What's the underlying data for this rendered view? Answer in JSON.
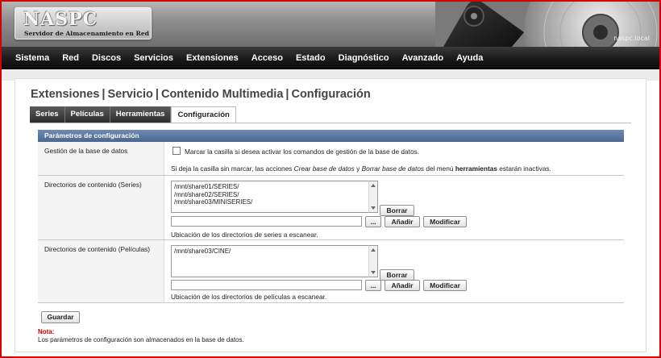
{
  "header": {
    "logo_title": "NASPC",
    "logo_subtitle": "Servidor de Almacenamiento en Red",
    "hostname": "naspc.local"
  },
  "nav": {
    "items": [
      "Sistema",
      "Red",
      "Discos",
      "Servicios",
      "Extensiones",
      "Acceso",
      "Estado",
      "Diagnóstico",
      "Avanzado",
      "Ayuda"
    ]
  },
  "breadcrumb": {
    "parts": [
      "Extensiones",
      "Servicio",
      "Contenido Multimedia",
      "Configuración"
    ],
    "separator": "|"
  },
  "tabs": [
    {
      "label": "Series",
      "active": false
    },
    {
      "label": "Películas",
      "active": false
    },
    {
      "label": "Herramientas",
      "active": false
    },
    {
      "label": "Configuración",
      "active": true
    }
  ],
  "form": {
    "section_title": "Parámetros de configuración",
    "db_row": {
      "label": "Gestión de la base de datos",
      "checkbox_label": "Marcar la casilla si desea activar los comandos de gestión de la base de datos.",
      "checked": false,
      "help_prefix": "Si deja la casilla sin marcar, las acciones ",
      "help_em1": "Crear base de datos",
      "help_mid": " y ",
      "help_em2": "Borrar base de datos",
      "help_mid2": " del menú ",
      "help_strong": "herramientas",
      "help_suffix": " estarán inactivas."
    },
    "series_row": {
      "label": "Directorios de contenido (Series)",
      "entries": [
        "/mnt/share01/SERIES/",
        "/mnt/share02/SERIES/",
        "/mnt/share03/MINISERIES/"
      ],
      "input_value": "",
      "browse_label": "...",
      "add_label": "Añadir",
      "modify_label": "Modificar",
      "delete_label": "Borrar",
      "help": "Ubicación de los directorios de series a escanear."
    },
    "movies_row": {
      "label": "Directorios de contenido (Películas)",
      "entries": [
        "/mnt/share03/CINE/"
      ],
      "input_value": "",
      "browse_label": "...",
      "add_label": "Añadir",
      "modify_label": "Modificar",
      "delete_label": "Borrar",
      "help": "Ubicación de los directorios de películas a escanear."
    },
    "save_label": "Guardar",
    "note_title": "Nota:",
    "note_text": "Los parámetros de configuración son almacenados en la base de datos."
  },
  "colors": {
    "frame": "#d40000",
    "nav_bg": "#1a1a1a",
    "section_head": "#5a77a0",
    "note": "#cc0000"
  }
}
